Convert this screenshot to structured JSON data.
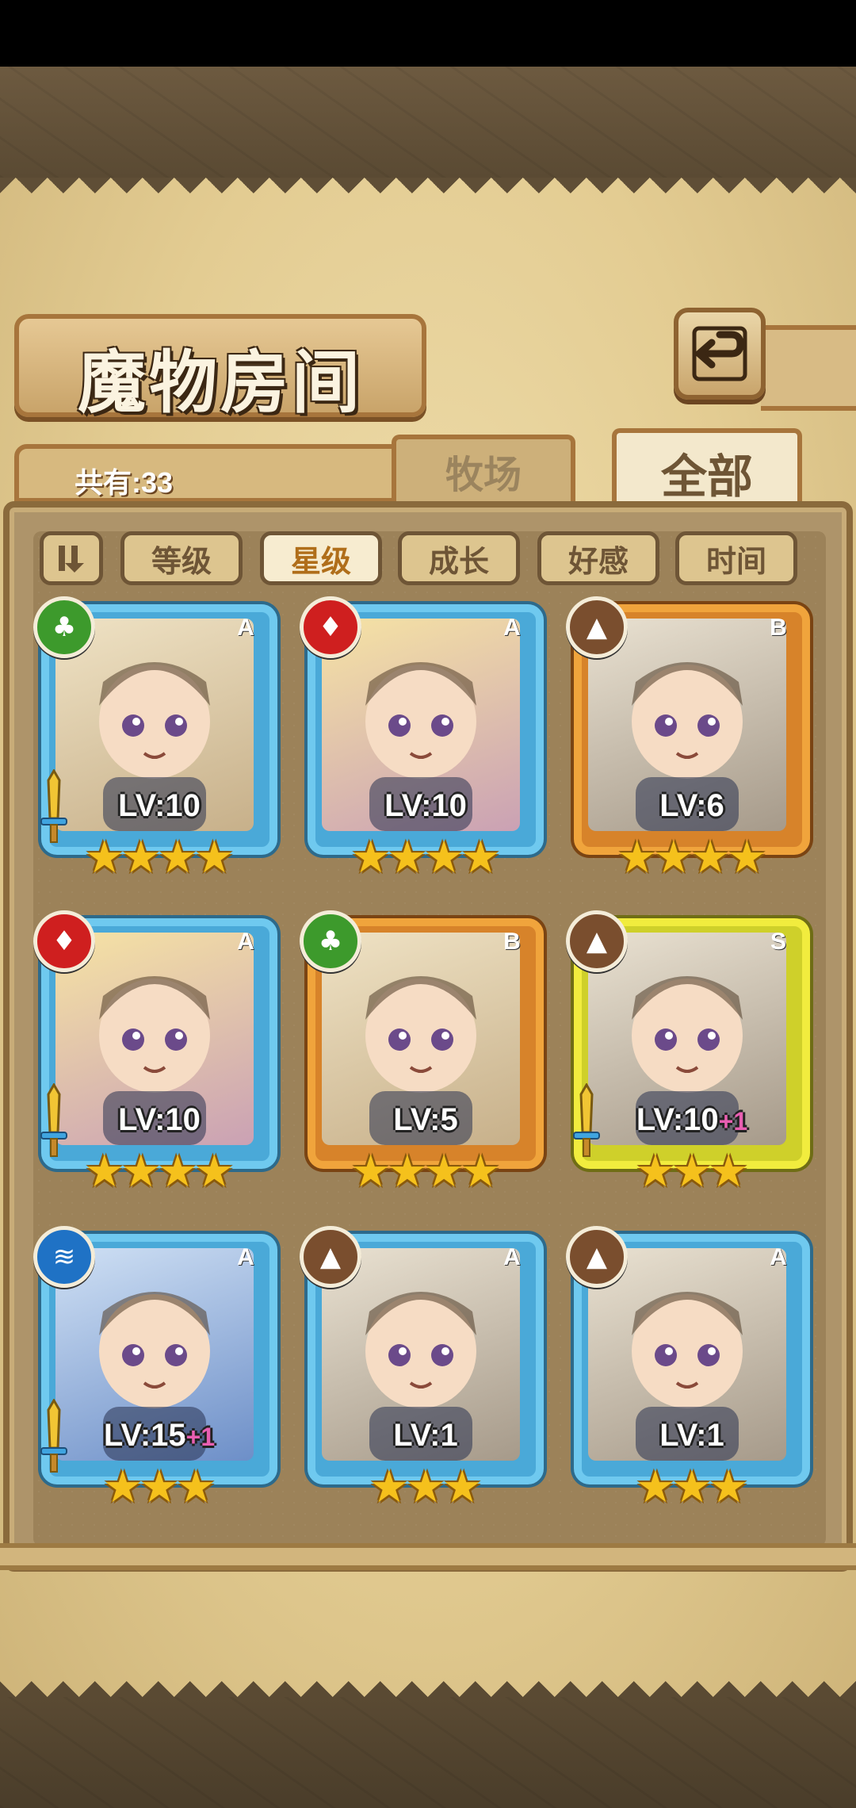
{
  "header": {
    "title": "魔物房间",
    "back_icon": "back-arrow-icon",
    "count_label": "共有:33"
  },
  "tabs": [
    {
      "label": "牧场",
      "active": false
    },
    {
      "label": "全部",
      "active": true
    }
  ],
  "sort_buttons": [
    {
      "label": "等级",
      "active": false
    },
    {
      "label": "星级",
      "active": true
    },
    {
      "label": "成长",
      "active": false
    },
    {
      "label": "好感",
      "active": false
    },
    {
      "label": "时间",
      "active": false
    }
  ],
  "sort_toggle_icon": "sort-direction-icon",
  "colors": {
    "frame_blue": "#6fc9ef",
    "frame_orange": "#f0a43c",
    "frame_yellow": "#f1ec3e",
    "star": "#f5c11c",
    "bonus": "#e85fb1"
  },
  "monsters": [
    {
      "element": "nature",
      "rank": "A",
      "level": "LV:10",
      "bonus": "",
      "stars": 4,
      "weapon": true,
      "frame": "blue"
    },
    {
      "element": "fire",
      "rank": "A",
      "level": "LV:10",
      "bonus": "",
      "stars": 4,
      "weapon": false,
      "frame": "blue"
    },
    {
      "element": "earth",
      "rank": "B",
      "level": "LV:6",
      "bonus": "",
      "stars": 4,
      "weapon": false,
      "frame": "orange"
    },
    {
      "element": "fire",
      "rank": "A",
      "level": "LV:10",
      "bonus": "",
      "stars": 4,
      "weapon": true,
      "frame": "blue"
    },
    {
      "element": "nature",
      "rank": "B",
      "level": "LV:5",
      "bonus": "",
      "stars": 4,
      "weapon": false,
      "frame": "orange"
    },
    {
      "element": "earth",
      "rank": "S",
      "level": "LV:10",
      "bonus": "+1",
      "stars": 3,
      "weapon": true,
      "frame": "yellow"
    },
    {
      "element": "water",
      "rank": "A",
      "level": "LV:15",
      "bonus": "+1",
      "stars": 3,
      "weapon": true,
      "frame": "blue"
    },
    {
      "element": "earth",
      "rank": "A",
      "level": "LV:1",
      "bonus": "",
      "stars": 3,
      "weapon": false,
      "frame": "blue"
    },
    {
      "element": "earth",
      "rank": "A",
      "level": "LV:1",
      "bonus": "",
      "stars": 3,
      "weapon": false,
      "frame": "blue"
    }
  ]
}
